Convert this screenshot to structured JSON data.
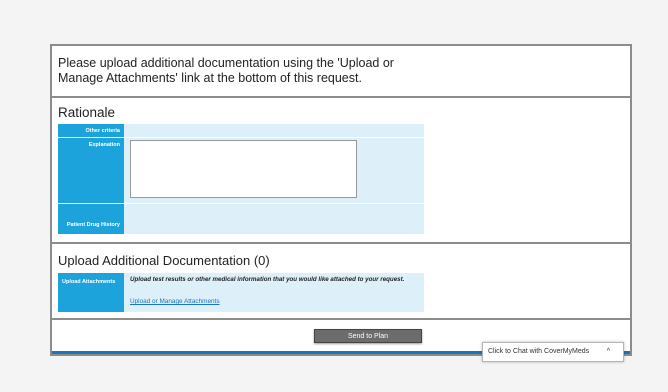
{
  "notice": {
    "text": "Please upload additional documentation using the 'Upload or Manage Attachments' link at the bottom of this request."
  },
  "rationale": {
    "title": "Rationale",
    "rows": [
      {
        "label": "Other criteria"
      },
      {
        "label": "Explanation",
        "value": ""
      },
      {
        "label": "Patient Drug History"
      }
    ]
  },
  "upload": {
    "title": "Upload Additional Documentation (0)",
    "label": "Upload Attachments",
    "description": "Upload test results or other medical information that you would like attached to your request.",
    "link": "Upload or Manage Attachments"
  },
  "actions": {
    "send_label": "Send to Plan"
  },
  "chat": {
    "label": "Click to Chat with CoverMyMeds",
    "caret": "^"
  }
}
